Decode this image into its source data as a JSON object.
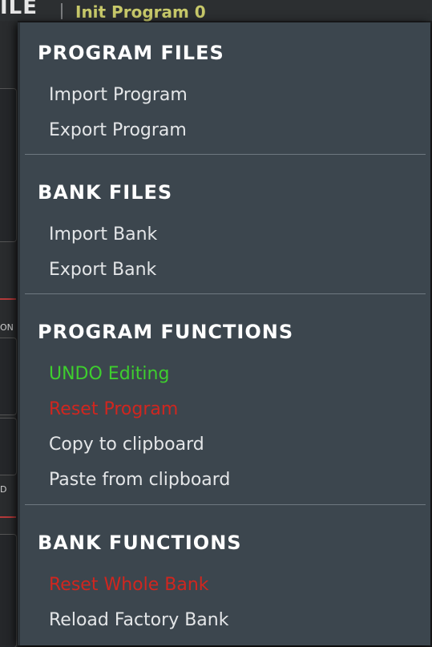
{
  "background": {
    "left_text": "ILE",
    "program_name": "Init Program 0",
    "side_labels": [
      "ON",
      "D"
    ]
  },
  "menu": {
    "sections": [
      {
        "title": "PROGRAM FILES",
        "items": [
          {
            "label": "Import Program",
            "color": "#e4e6e8"
          },
          {
            "label": "Export Program",
            "color": "#e4e6e8"
          }
        ]
      },
      {
        "title": "BANK FILES",
        "items": [
          {
            "label": "Import Bank",
            "color": "#e4e6e8"
          },
          {
            "label": "Export Bank",
            "color": "#e4e6e8"
          }
        ]
      },
      {
        "title": "PROGRAM FUNCTIONS",
        "items": [
          {
            "label": "UNDO Editing",
            "color": "#3ecf2e"
          },
          {
            "label": "Reset Program",
            "color": "#d0261f"
          },
          {
            "label": "Copy to clipboard",
            "color": "#e4e6e8"
          },
          {
            "label": "Paste from clipboard",
            "color": "#e4e6e8"
          }
        ]
      },
      {
        "title": "BANK FUNCTIONS",
        "items": [
          {
            "label": "Reset Whole Bank",
            "color": "#d0261f"
          },
          {
            "label": "Reload Factory Bank",
            "color": "#e4e6e8"
          }
        ]
      }
    ]
  },
  "colors": {
    "menu_background": "#3c464e",
    "title": "#ffffff",
    "item": "#e4e6e8",
    "undo": "#3ecf2e",
    "destructive": "#d0261f"
  }
}
